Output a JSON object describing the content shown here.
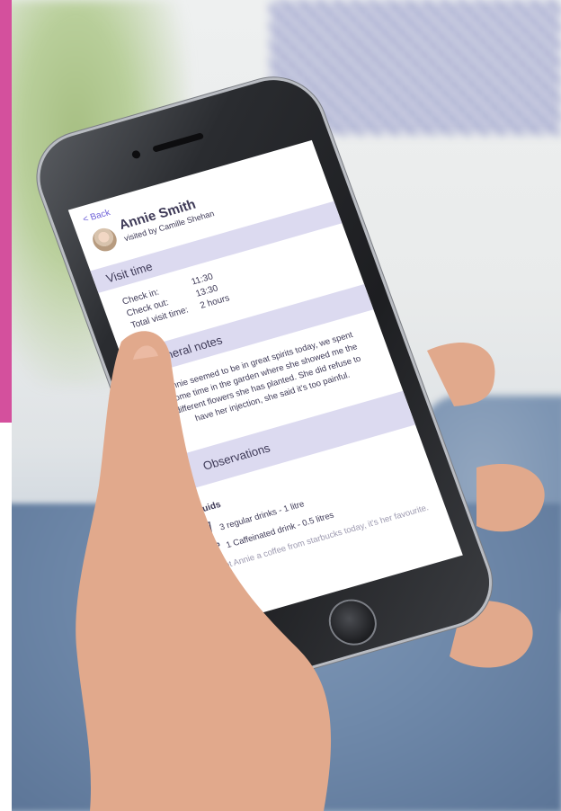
{
  "app": {
    "back_label": "< Back",
    "patient_name": "Annie Smith",
    "visited_by": "visited by Camille Shehan"
  },
  "visit_time": {
    "heading": "Visit time",
    "rows": [
      {
        "label": "Check in:",
        "value": "11:30"
      },
      {
        "label": "Check out:",
        "value": "13:30"
      },
      {
        "label": "Total visit time:",
        "value": "2 hours"
      }
    ]
  },
  "general_notes": {
    "heading": "General notes",
    "text": "Annie seemed to be in great spirits today, we spent some time in the garden where she showed me the different flowers she has planted. She did refuse to have her injection, she said it's too painful."
  },
  "observations": {
    "heading": "Observations",
    "fluids_title": "Fluids",
    "items": [
      {
        "icon": "cup-icon",
        "label": "3 regular drinks - 1 litre"
      },
      {
        "icon": "coffee-cup-icon",
        "label": "1 Caffeinated drink - 0.5 litres"
      }
    ],
    "note": "I got Annie a coffee from starbucks today, it's her favourite."
  },
  "colors": {
    "accent": "#6f62d8",
    "section_bar": "#dcdaf0",
    "text": "#3e3a57",
    "brand_strip": "#d4509d"
  }
}
